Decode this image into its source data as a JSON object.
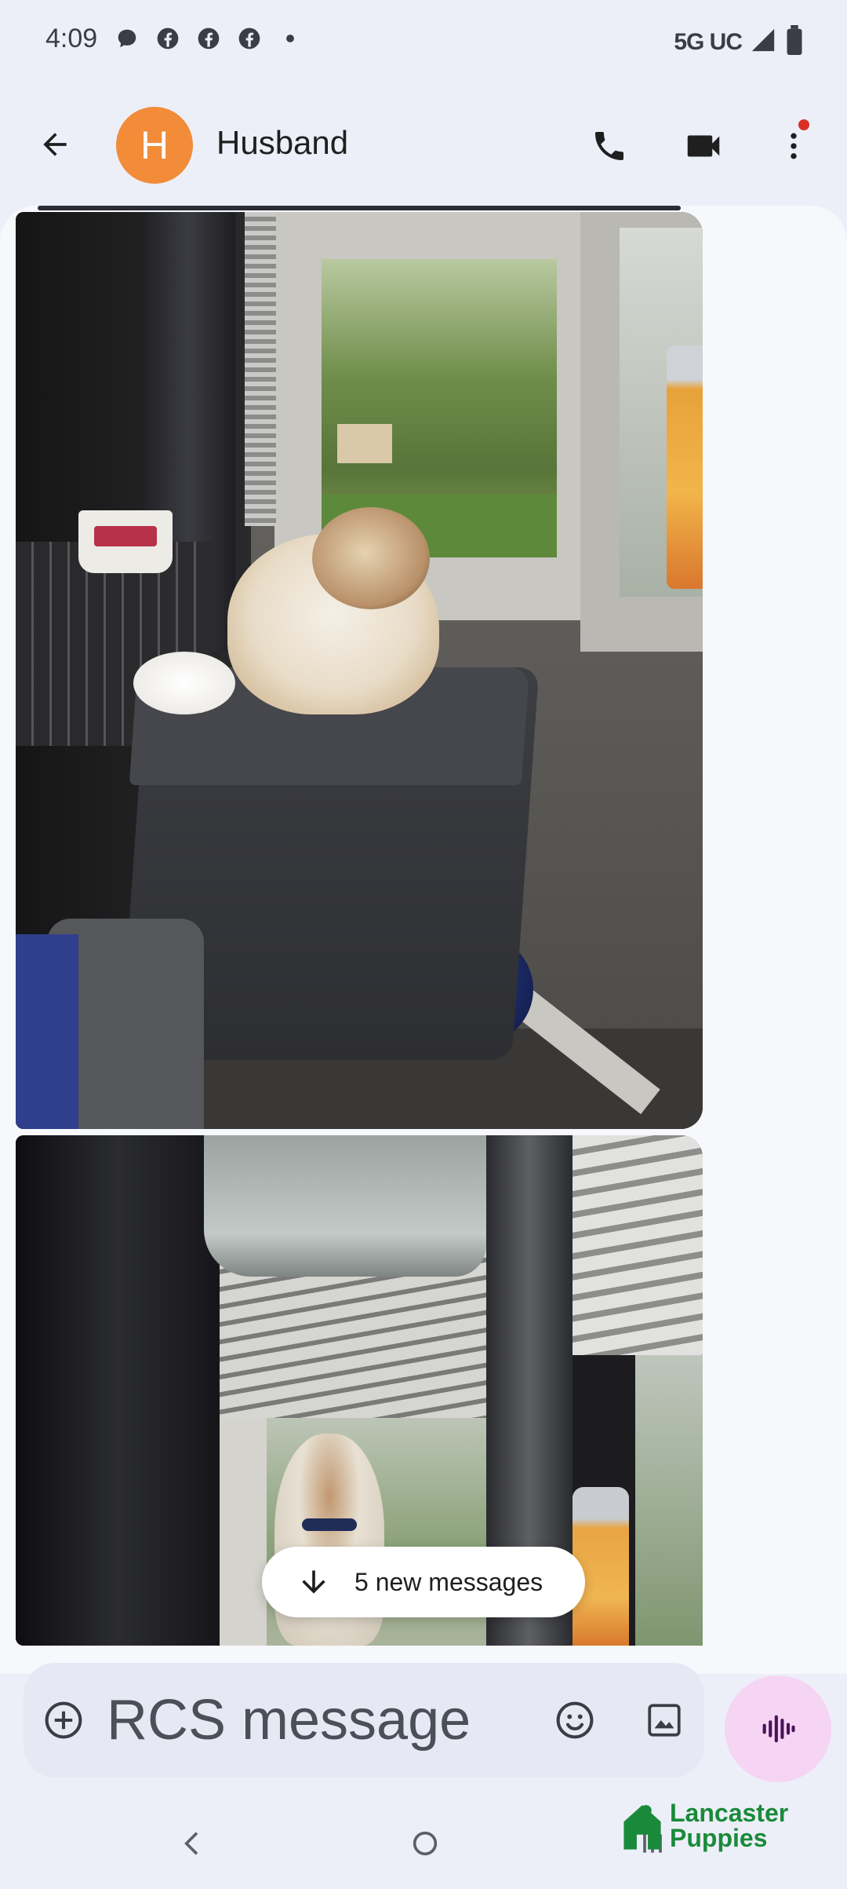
{
  "status_bar": {
    "time": "4:09",
    "network": "5G UC",
    "notification_icons": [
      "chat-bubble-icon",
      "facebook-icon",
      "facebook-icon",
      "facebook-icon",
      "more-dot-icon"
    ]
  },
  "header": {
    "avatar_letter": "H",
    "avatar_color": "#f28c38",
    "contact_name": "Husband",
    "menu_badge_color": "#d93025"
  },
  "conversation": {
    "new_messages_label": "5 new messages"
  },
  "composer": {
    "placeholder": "RCS message",
    "voice_button_color": "#f6d4f4"
  },
  "watermark": {
    "line1": "Lancaster",
    "line2": "Puppies",
    "color": "#1a8a3a"
  }
}
